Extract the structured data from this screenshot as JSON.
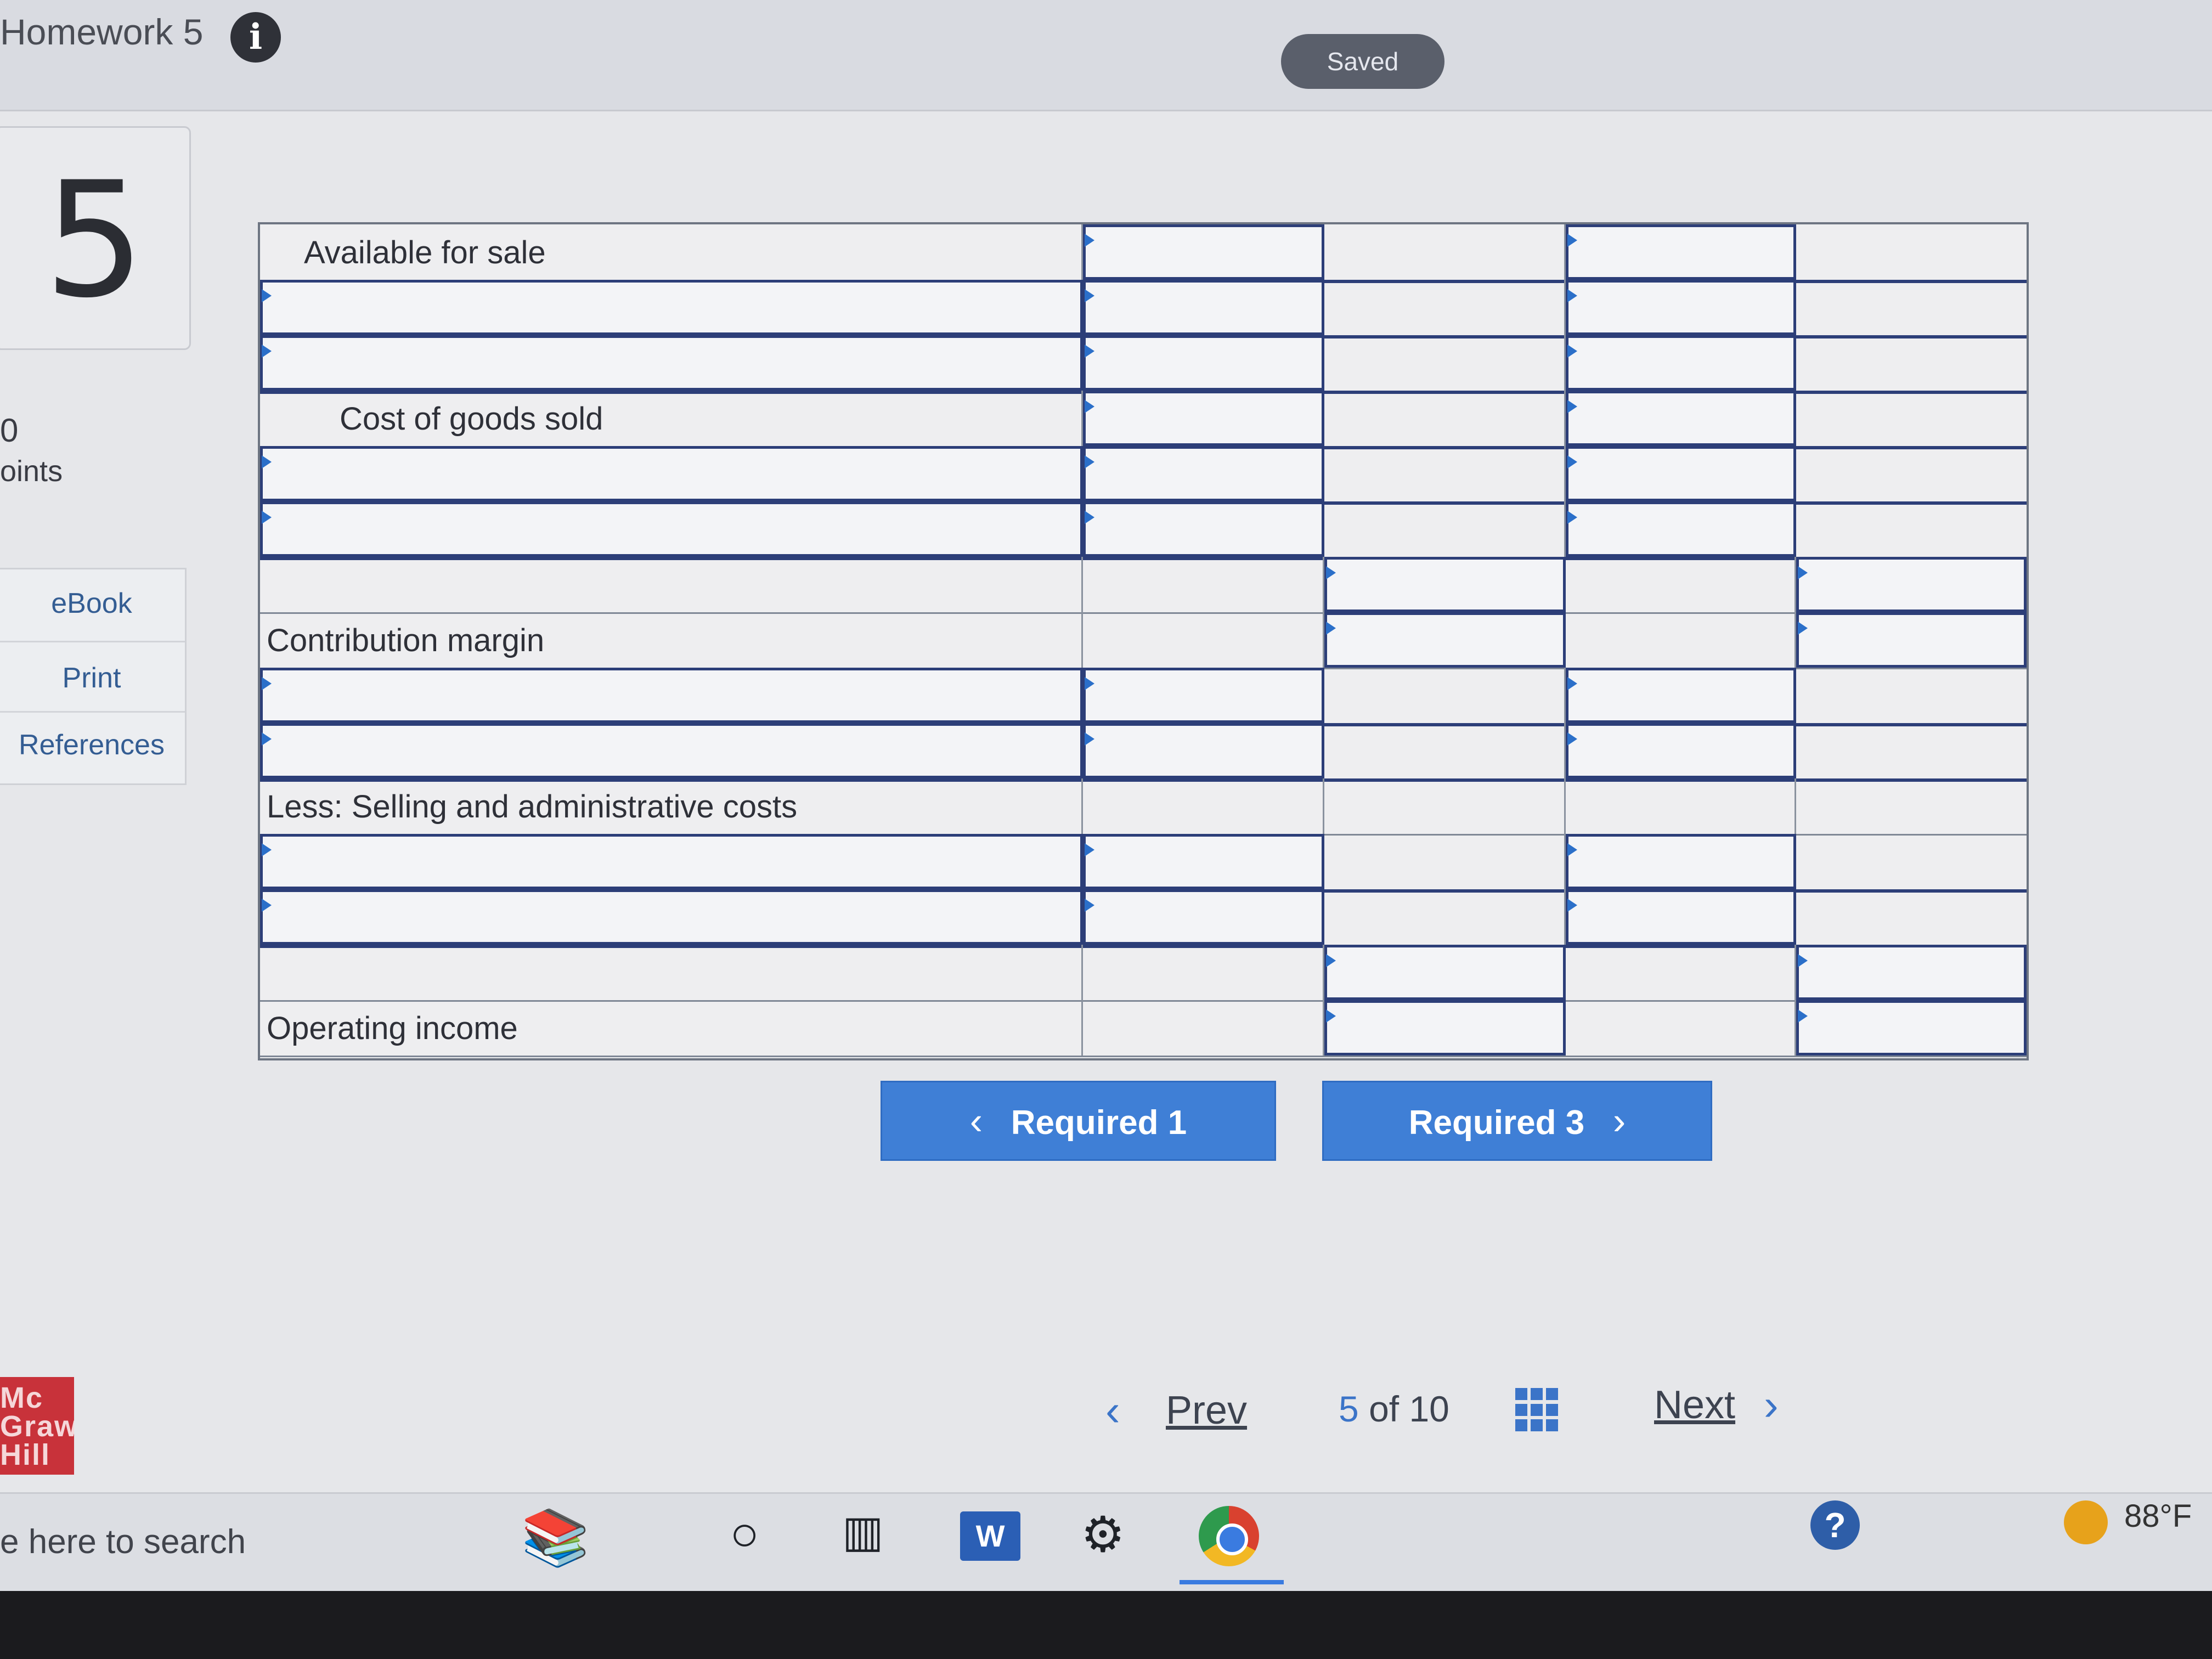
{
  "header": {
    "title": "Homework 5",
    "info_icon": "i",
    "saved": "Saved"
  },
  "question": {
    "number": "5",
    "points_value": "0",
    "points_label": "oints"
  },
  "side_menu": [
    "eBook",
    "Print",
    "References"
  ],
  "table": {
    "rows": [
      {
        "label": "Available for sale",
        "indent": 1,
        "inputs": [
          1,
          0,
          1,
          0
        ]
      },
      {
        "label": "",
        "indent": 0,
        "inputs": [
          1,
          0,
          1,
          0
        ]
      },
      {
        "label": "",
        "indent": 0,
        "inputs": [
          1,
          0,
          1,
          0
        ]
      },
      {
        "label": "Cost of goods sold",
        "indent": 2,
        "inputs": [
          1,
          0,
          1,
          0
        ]
      },
      {
        "label": "",
        "indent": 0,
        "inputs": [
          1,
          0,
          1,
          0
        ]
      },
      {
        "label": "",
        "indent": 0,
        "inputs": [
          1,
          0,
          1,
          0
        ]
      },
      {
        "label": "",
        "indent": 0,
        "inputs": [
          0,
          1,
          0,
          1
        ]
      },
      {
        "label": "Contribution margin",
        "indent": 0,
        "inputs": [
          0,
          1,
          0,
          1
        ]
      },
      {
        "label": "",
        "indent": 0,
        "inputs": [
          1,
          0,
          1,
          0
        ]
      },
      {
        "label": "",
        "indent": 0,
        "inputs": [
          1,
          0,
          1,
          0
        ]
      },
      {
        "label": "Less: Selling and administrative costs",
        "indent": 0,
        "inputs": [
          0,
          0,
          0,
          0
        ]
      },
      {
        "label": "",
        "indent": 0,
        "inputs": [
          1,
          0,
          1,
          0
        ]
      },
      {
        "label": "",
        "indent": 0,
        "inputs": [
          1,
          0,
          1,
          0
        ]
      },
      {
        "label": "",
        "indent": 0,
        "inputs": [
          0,
          1,
          0,
          1
        ]
      },
      {
        "label": "Operating income",
        "indent": 0,
        "inputs": [
          0,
          1,
          0,
          1
        ]
      }
    ]
  },
  "buttons": {
    "prev_required": "Required 1",
    "next_required": "Required 3"
  },
  "nav": {
    "prev": "Prev",
    "current": "5",
    "of": "of",
    "total": "10",
    "next": "Next"
  },
  "logo": {
    "text": "Mc Graw Hill"
  },
  "taskbar": {
    "search_text": "e here to search",
    "word": "W",
    "help": "?",
    "weather": "88°F"
  },
  "colors": {
    "accent": "#3f7fd6",
    "input_border": "#2c3e78",
    "logo": "#c8323a"
  }
}
